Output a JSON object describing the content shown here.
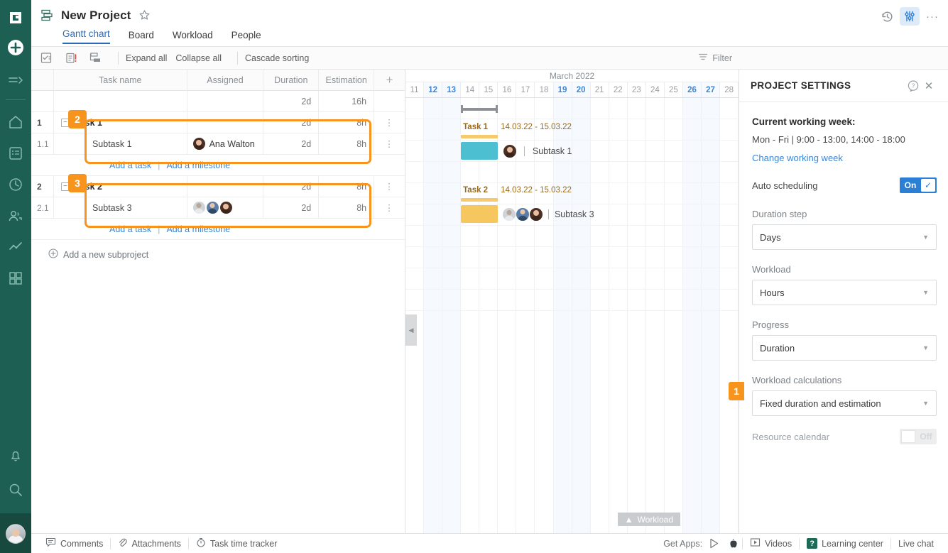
{
  "rail": {
    "logo": "G",
    "items": [
      {
        "name": "add-icon",
        "label": "Add"
      },
      {
        "name": "expand-menu-icon",
        "label": "Expand menu"
      },
      {
        "name": "home-icon",
        "label": "Home"
      },
      {
        "name": "tasks-icon",
        "label": "My tasks"
      },
      {
        "name": "time-icon",
        "label": "Time log"
      },
      {
        "name": "people-icon",
        "label": "People"
      },
      {
        "name": "reports-icon",
        "label": "Reports"
      },
      {
        "name": "apps-icon",
        "label": "Apps"
      },
      {
        "name": "bell-icon",
        "label": "Notifications"
      },
      {
        "name": "search-icon",
        "label": "Search"
      }
    ]
  },
  "header": {
    "project_name": "New Project",
    "star_glyph": "☆",
    "tabs": [
      {
        "label": "Gantt chart",
        "active": true
      },
      {
        "label": "Board",
        "active": false
      },
      {
        "label": "Workload",
        "active": false
      },
      {
        "label": "People",
        "active": false
      }
    ],
    "right_icons": [
      {
        "name": "history-icon",
        "selected": false
      },
      {
        "name": "settings-sliders-icon",
        "selected": true
      },
      {
        "name": "more-options-icon",
        "selected": false,
        "glyph": "···"
      }
    ]
  },
  "toolbar": {
    "icons": [
      "checklist-icon",
      "critical-path-icon",
      "indent-icon"
    ],
    "links": [
      "Expand all",
      "Collapse all",
      "Cascade sorting"
    ],
    "filter_label": "Filter"
  },
  "grid": {
    "columns": [
      "",
      "Task name",
      "Assigned",
      "Duration",
      "Estimation",
      "+"
    ],
    "rows": [
      {
        "id": "",
        "name": "",
        "bold": false,
        "indent": 0,
        "toggle": null,
        "assigned": [],
        "assigned_name": "",
        "duration": "2d",
        "estimation": "16h",
        "menu": false
      },
      {
        "id": "1",
        "name": "Task 1",
        "bold": true,
        "indent": 0,
        "toggle": "−",
        "assigned": [],
        "assigned_name": "",
        "duration": "2d",
        "estimation": "8h",
        "menu": true
      },
      {
        "id": "1.1",
        "name": "Subtask 1",
        "bold": false,
        "indent": 1,
        "toggle": null,
        "assigned": [
          "a3"
        ],
        "assigned_name": "Ana Walton",
        "duration": "2d",
        "estimation": "8h",
        "menu": true
      }
    ],
    "add_task_label": "Add a task",
    "add_milestone_label": "Add a milestone",
    "rows2": [
      {
        "id": "2",
        "name": "Task 2",
        "bold": true,
        "indent": 0,
        "toggle": "−",
        "assigned": [],
        "assigned_name": "",
        "duration": "2d",
        "estimation": "8h",
        "menu": true
      },
      {
        "id": "2.1",
        "name": "Subtask 3",
        "bold": false,
        "indent": 1,
        "toggle": null,
        "assigned": [
          "a1",
          "a2",
          "a3"
        ],
        "assigned_name": "",
        "duration": "2d",
        "estimation": "8h",
        "menu": true
      }
    ],
    "add_subproject_label": "Add a new subproject"
  },
  "gantt": {
    "month_label": "March 2022",
    "days": [
      {
        "d": "11",
        "weekend": false
      },
      {
        "d": "12",
        "weekend": true
      },
      {
        "d": "13",
        "weekend": true
      },
      {
        "d": "14",
        "weekend": false
      },
      {
        "d": "15",
        "weekend": false
      },
      {
        "d": "16",
        "weekend": false
      },
      {
        "d": "17",
        "weekend": false
      },
      {
        "d": "18",
        "weekend": false
      },
      {
        "d": "19",
        "weekend": true
      },
      {
        "d": "20",
        "weekend": true
      },
      {
        "d": "21",
        "weekend": false
      },
      {
        "d": "22",
        "weekend": false
      },
      {
        "d": "23",
        "weekend": false
      },
      {
        "d": "24",
        "weekend": false
      },
      {
        "d": "25",
        "weekend": false
      },
      {
        "d": "26",
        "weekend": true
      },
      {
        "d": "27",
        "weekend": true
      },
      {
        "d": "28",
        "weekend": false
      }
    ],
    "bars": {
      "task1_label": "Task 1",
      "task1_dates": "14.03.22 - 15.03.22",
      "subtask1_label": "Subtask 1",
      "task2_label": "Task 2",
      "task2_dates": "14.03.22 - 15.03.22",
      "subtask3_label": "Subtask 3",
      "teal_color": "#4cbfd0",
      "amber_color": "#f6c75e",
      "summary_color": "#f5c96c"
    },
    "workload_button": "Workload"
  },
  "panel": {
    "title": "PROJECT SETTINGS",
    "help_glyph": "?",
    "close_glyph": "✕",
    "working_week_title": "Current working week:",
    "working_week_value": "Mon - Fri | 9:00 - 13:00,  14:00 - 18:00",
    "change_link": "Change working week",
    "auto_scheduling_label": "Auto scheduling",
    "auto_scheduling_state": "On",
    "fields": [
      {
        "label": "Duration step",
        "value": "Days"
      },
      {
        "label": "Workload",
        "value": "Hours"
      },
      {
        "label": "Progress",
        "value": "Duration"
      },
      {
        "label": "Workload calculations",
        "value": "Fixed duration and estimation"
      }
    ],
    "resource_calendar_label": "Resource calendar",
    "resource_calendar_state": "Off"
  },
  "bottom": {
    "left_items": [
      {
        "label": "Comments",
        "icon": "comment-icon"
      },
      {
        "label": "Attachments",
        "icon": "paperclip-icon"
      },
      {
        "label": "Task time tracker",
        "icon": "stopwatch-icon"
      }
    ],
    "get_apps_label": "Get Apps:",
    "right_items": [
      {
        "label": "Videos",
        "icon": "video-icon"
      },
      {
        "label": "Learning center",
        "icon": "question-badge-icon"
      },
      {
        "label": "Live chat",
        "icon": ""
      }
    ]
  },
  "annotations": [
    {
      "number": "1",
      "target": "workload-calculations-field"
    },
    {
      "number": "2",
      "target": "task1-group-rows"
    },
    {
      "number": "3",
      "target": "task2-group-rows"
    }
  ],
  "colors": {
    "accent_orange": "#f6941d",
    "brand_green": "#1d5f52",
    "link_blue": "#3b86d6",
    "toggle_blue": "#2b7fd4"
  }
}
